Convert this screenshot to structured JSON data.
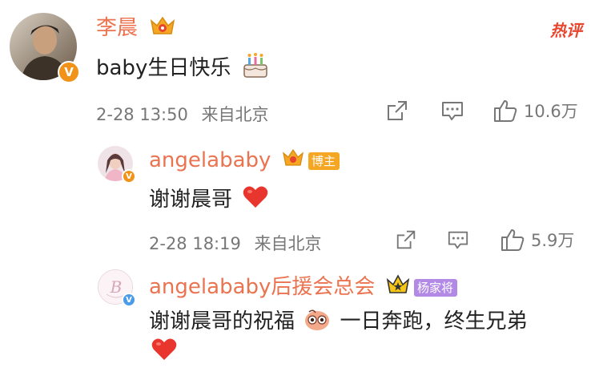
{
  "hot_label": "热评",
  "comments": [
    {
      "user": "李晨",
      "text": "baby生日快乐",
      "time": "2-28 13:50",
      "source": "来自北京",
      "likes": "10.6万"
    },
    {
      "user": "angelababy",
      "tag": "博主",
      "text": "谢谢晨哥",
      "time": "2-28 18:19",
      "source": "来自北京",
      "likes": "5.9万"
    },
    {
      "user": "angelababy后援会总会",
      "tag": "杨家将",
      "text_part1": "谢谢晨哥的祝福",
      "text_part2": "一日奔跑，终生兄弟"
    }
  ],
  "colors": {
    "username": "#eb7350",
    "hot": "#e8452e",
    "blogger_tag": "#f5a623",
    "fan_tag": "#b28ae6",
    "verified_orange": "#f19318",
    "verified_blue": "#4a9be8"
  }
}
